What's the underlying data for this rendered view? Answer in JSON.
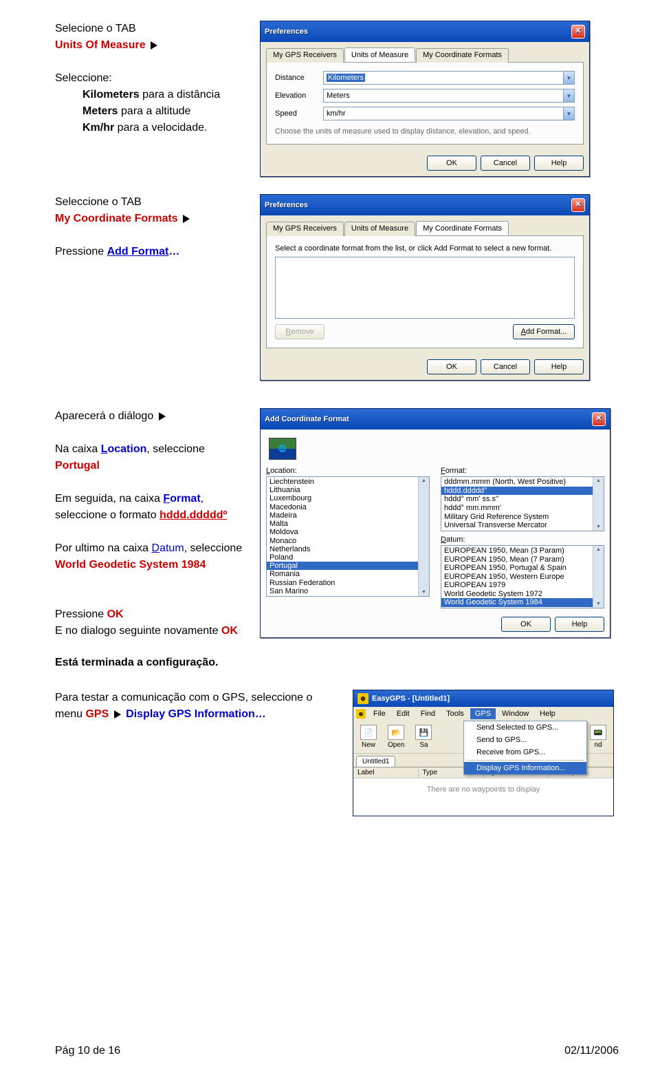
{
  "section1": {
    "line1": "Selecione o TAB",
    "line2": "Units Of Measure",
    "line3": "Seleccione:",
    "li1a": "Kilometers",
    "li1b": " para a distância",
    "li2a": "Meters",
    "li2b": " para a altitude",
    "li3a": "Km/hr",
    "li3b": " para a velocidade."
  },
  "prefs1": {
    "title": "Preferences",
    "tabs": [
      "My GPS Receivers",
      "Units of Measure",
      "My Coordinate Formats"
    ],
    "activeTab": 1,
    "labels": {
      "distance": "Distance",
      "elevation": "Elevation",
      "speed": "Speed"
    },
    "values": {
      "distance": "Kilometers",
      "elevation": "Meters",
      "speed": "km/hr"
    },
    "hint": "Choose the units of measure used to display distance, elevation, and speed.",
    "buttons": {
      "ok": "OK",
      "cancel": "Cancel",
      "help": "Help"
    }
  },
  "section2": {
    "line1": "Seleccione o TAB",
    "line2": "My Coordinate Formats",
    "line3a": "Pressione ",
    "line3b": "Add Format"
  },
  "prefs2": {
    "title": "Preferences",
    "tabs": [
      "My GPS Receivers",
      "Units of Measure",
      "My Coordinate Formats"
    ],
    "desc": "Select a coordinate format from the list, or click Add Format to select a new format.",
    "removeBtn": "Remove",
    "addBtn": "Add Format...",
    "buttons": {
      "ok": "OK",
      "cancel": "Cancel",
      "help": "Help"
    }
  },
  "section3": {
    "p1": "Aparecerá o diálogo",
    "p2a": "Na caixa ",
    "p2b": "Location",
    "p2c": ", seleccione ",
    "p2d": "Portugal",
    "p3a": "Em seguida, na caixa ",
    "p3b": "Format",
    "p3c": ", seleccione o formato ",
    "p3d": "hddd.dddddº",
    "p4a": "Por ultimo na caixa ",
    "p4b": "Datum",
    "p4c": ", seleccione ",
    "p4d": "World Geodetic System 1984",
    "p5a": "Pressione ",
    "p5b": "OK",
    "p6a": "E no dialogo seguinte novamente ",
    "p6b": "OK"
  },
  "acf": {
    "title": "Add Coordinate Format",
    "locLabel": "Location:",
    "locItems": [
      "Liechtenstein",
      "Lithuania",
      "Luxembourg",
      "Macedonia",
      "Madeira",
      "Malta",
      "Moldova",
      "Monaco",
      "Netherlands",
      "Poland",
      "Portugal",
      "Romania",
      "Russian Federation",
      "San Marino"
    ],
    "locSel": "Portugal",
    "fmtLabel": "Format:",
    "fmtItems": [
      "dddmm.mmm (North, West Positive)",
      "hddd.ddddd°",
      "hddd° mm' ss.s''",
      "hddd° mm.mmm'",
      "Military Grid Reference System",
      "Universal Transverse Mercator"
    ],
    "fmtSel": "hddd.ddddd°",
    "datLabel": "Datum:",
    "datItems": [
      "EUROPEAN 1950, Mean (3 Param)",
      "EUROPEAN 1950, Mean (7 Param)",
      "EUROPEAN 1950, Portugal & Spain",
      "EUROPEAN 1950, Western Europe",
      "EUROPEAN 1979",
      "World Geodetic System 1972",
      "World Geodetic System 1984"
    ],
    "datSel": "World Geodetic System 1984",
    "buttons": {
      "ok": "OK",
      "help": "Help"
    }
  },
  "done": "Está terminada a configuração.",
  "test": {
    "a": "Para testar a comunicação com o GPS, seleccione o menu ",
    "b": "GPS",
    "c": "Display GPS Information"
  },
  "app": {
    "title": "EasyGPS - [Untitled1]",
    "menus": [
      "File",
      "Edit",
      "Find",
      "Tools",
      "GPS",
      "Window",
      "Help"
    ],
    "openMenu": "GPS",
    "menuItems": [
      "Send Selected to GPS...",
      "Send to GPS...",
      "Receive from GPS...",
      "Display GPS Information..."
    ],
    "menuSel": "Display GPS Information...",
    "tools": [
      "New",
      "Open",
      "Sa",
      "nd"
    ],
    "tab": "Untitled1",
    "cols": [
      "Label",
      "Type",
      "Symbol",
      "Description"
    ],
    "empty": "There are no waypoints to display"
  },
  "footer": {
    "left": "Pág 10 de 16",
    "right": "02/11/2006"
  }
}
